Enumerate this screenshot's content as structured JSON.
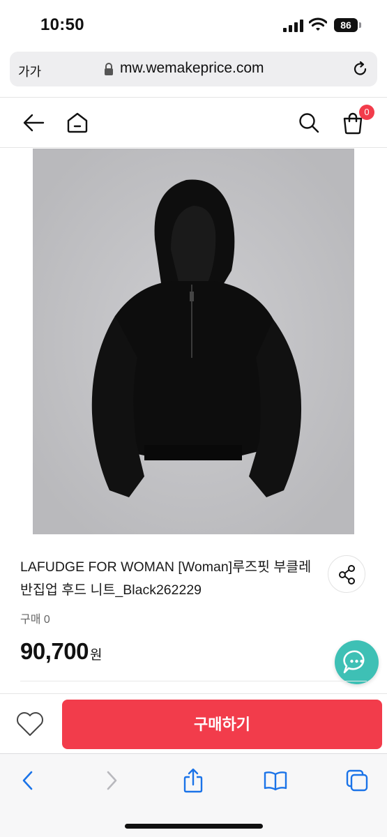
{
  "status_bar": {
    "time": "10:50",
    "battery": "86"
  },
  "browser": {
    "text_size_label": "가가",
    "url": "mw.wemakeprice.com"
  },
  "app_nav": {
    "cart_count": "0"
  },
  "product": {
    "title": "LAFUDGE FOR WOMAN [Woman]루즈핏 부클레 반집업 후드 니트_Black262229",
    "sold_label": "구매 0",
    "price": "90,700",
    "currency": "원"
  },
  "actions": {
    "buy_label": "구매하기"
  },
  "icons": [
    "back-arrow-icon",
    "home-icon",
    "search-icon",
    "cart-icon",
    "share-icon",
    "chat-icon",
    "heart-icon",
    "lock-icon",
    "reload-icon",
    "safari-back-icon",
    "safari-forward-icon",
    "safari-share-icon",
    "bookmarks-icon",
    "tabs-icon"
  ],
  "colors": {
    "accent": "#f23c4b",
    "chat": "#3ec0b5"
  }
}
